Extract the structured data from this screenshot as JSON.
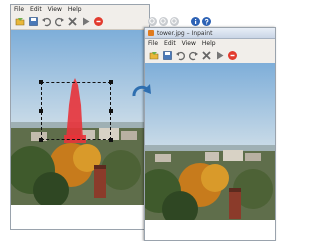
{
  "left_window": {
    "menu": [
      "File",
      "Edit",
      "View",
      "Help"
    ]
  },
  "right_window": {
    "title": "tower.jpg – Inpaint",
    "menu": [
      "File",
      "Edit",
      "View",
      "Help"
    ]
  },
  "toolbar_icons": [
    "open-icon",
    "save-icon",
    "undo-icon",
    "redo-icon",
    "clear-icon",
    "run-icon",
    "stop-icon"
  ],
  "colors": {
    "selection_fill": "#e8333a",
    "run_button": "#e23b2e",
    "arrow": "#2f6fb0",
    "titlebar_icon": "#e07b1f"
  }
}
